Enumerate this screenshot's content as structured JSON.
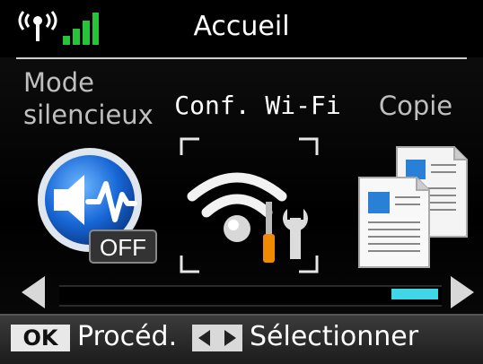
{
  "header": {
    "title": "Accueil",
    "antenna_icon": "wireless-antenna-icon",
    "signal_icon": "signal-strength-icon",
    "signal_color": "#27c43a"
  },
  "menu": {
    "items": [
      {
        "label_line1": "Mode",
        "label_line2": "silencieux",
        "icon": "speaker-off-icon",
        "badge": "OFF",
        "selected": false
      },
      {
        "label": "Conf. Wi-Fi",
        "icon": "wifi-setup-icon",
        "selected": true
      },
      {
        "label": "Copie",
        "icon": "copy-documents-icon",
        "selected": false
      }
    ],
    "scroll_position": 1.0,
    "accent_color": "#3fd7e6"
  },
  "footer": {
    "ok_key": "OK",
    "ok_hint": "Procéd.",
    "lr_hint": "Sélectionner"
  }
}
